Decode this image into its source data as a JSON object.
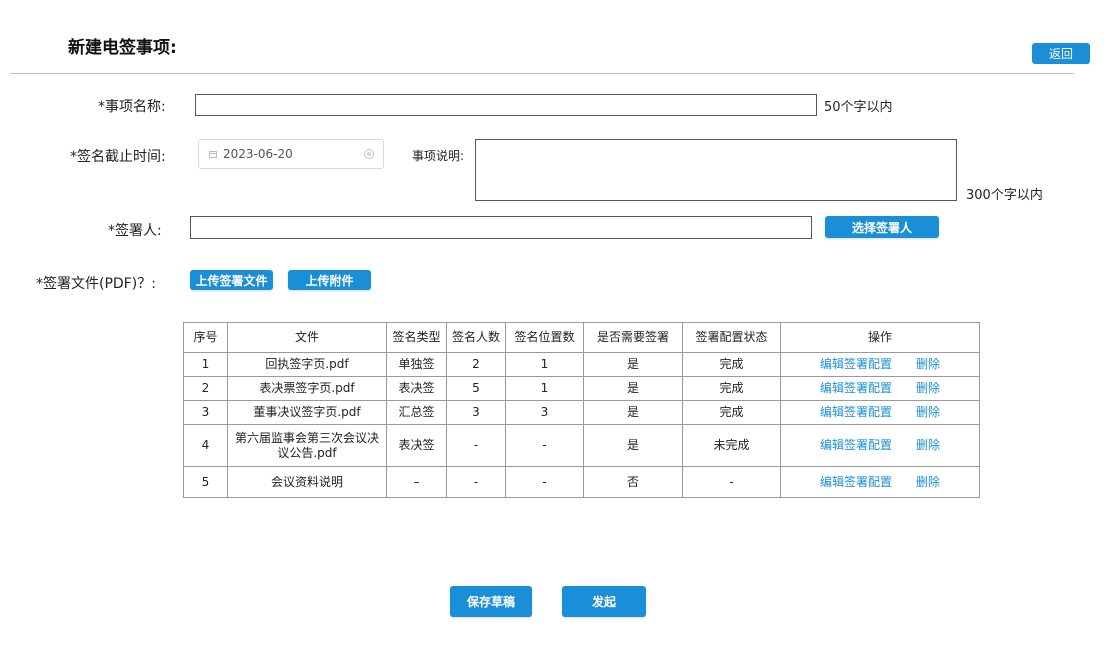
{
  "header": {
    "title": "新建电签事项:",
    "back_label": "返回"
  },
  "form": {
    "item_name": {
      "label": "*事项名称:",
      "value": "",
      "hint": "50个字以内"
    },
    "deadline": {
      "label": "*签名截止时间:",
      "value": "2023-06-20"
    },
    "description": {
      "label": "事项说明:",
      "value": "",
      "hint": "300个字以内"
    },
    "signers": {
      "label": "*签署人:",
      "value": "",
      "select_label": "选择签署人"
    },
    "files": {
      "label": "*签署文件(PDF)？:",
      "upload_sign_label": "上传签署文件",
      "upload_attach_label": "上传附件"
    }
  },
  "table": {
    "columns": [
      "序号",
      "文件",
      "签名类型",
      "签名人数",
      "签名位置数",
      "是否需要签署",
      "签署配置状态",
      "操作"
    ],
    "rows": [
      {
        "no": "1",
        "file": "回执签字页.pdf",
        "type": "单独签",
        "signers": "2",
        "positions": "1",
        "need": "是",
        "status": "完成",
        "edit": "编辑签署配置",
        "delete": "删除"
      },
      {
        "no": "2",
        "file": "表决票签字页.pdf",
        "type": "表决签",
        "signers": "5",
        "positions": "1",
        "need": "是",
        "status": "完成",
        "edit": "编辑签署配置",
        "delete": "删除"
      },
      {
        "no": "3",
        "file": "董事决议签字页.pdf",
        "type": "汇总签",
        "signers": "3",
        "positions": "3",
        "need": "是",
        "status": "完成",
        "edit": "编辑签署配置",
        "delete": "删除"
      },
      {
        "no": "4",
        "file": "第六届监事会第三次会议决议公告.pdf",
        "type": "表决签",
        "signers": "-",
        "positions": "-",
        "need": "是",
        "status": "未完成",
        "edit": "编辑签署配置",
        "delete": "删除"
      },
      {
        "no": "5",
        "file": "会议资料说明",
        "type": "–",
        "signers": "-",
        "positions": "-",
        "need": "否",
        "status": "-",
        "edit": "编辑签署配置",
        "delete": "删除"
      }
    ]
  },
  "footer": {
    "save_draft_label": "保存草稿",
    "submit_label": "发起"
  },
  "colors": {
    "accent": "#1a8fd8"
  }
}
